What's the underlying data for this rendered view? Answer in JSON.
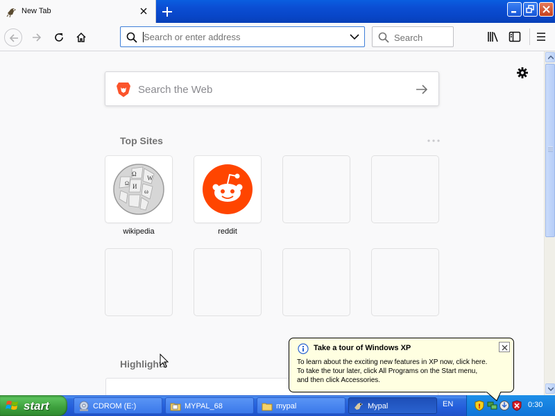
{
  "tab": {
    "title": "New Tab"
  },
  "urlbar": {
    "placeholder": "Search or enter address"
  },
  "searchbar": {
    "placeholder": "Search"
  },
  "websearch": {
    "placeholder": "Search the Web"
  },
  "topsites": {
    "title": "Top Sites",
    "sites": [
      {
        "label": "wikipedia"
      },
      {
        "label": "reddit"
      }
    ]
  },
  "highlights": {
    "title": "Highlights"
  },
  "balloon": {
    "title": "Take a tour of Windows XP",
    "line1": "To learn about the exciting new features in XP now, click here.",
    "line2": "To take the tour later, click All Programs on the Start menu,",
    "line3": "and then click Accessories."
  },
  "taskbar": {
    "start_label": "start",
    "tasks": [
      {
        "label": "CDROM (E:)"
      },
      {
        "label": "MYPAL_68"
      },
      {
        "label": "mypal"
      },
      {
        "label": "Mypal"
      }
    ],
    "language": "EN",
    "clock": "0:30"
  },
  "colors": {
    "accent_focus": "#3d7ed8",
    "reddit": "#ff4500",
    "brave": "#fb542b",
    "xp_blue": "#245edb",
    "xp_green": "#3d9f3d"
  },
  "icons": {
    "tab": "mypal-favicon",
    "nav": [
      "back-icon",
      "forward-icon",
      "reload-icon",
      "home-icon"
    ],
    "toolbar": [
      "library-icon",
      "sidebar-icon",
      "hamburger-menu-icon"
    ],
    "tray": [
      "security-shield-icon",
      "network-icon",
      "update-icon",
      "antivirus-icon"
    ]
  }
}
